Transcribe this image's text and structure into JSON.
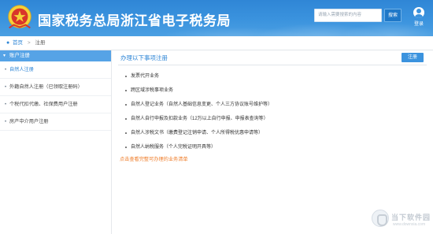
{
  "header": {
    "title": "国家税务总局浙江省电子税务局",
    "search": {
      "placeholder": "请输入需要搜索的内容",
      "button_label": "搜索"
    },
    "login_label": "登录",
    "colors": {
      "primary": "#3b93de",
      "accent_orange": "#ef7d2a"
    }
  },
  "breadcrumb": {
    "icon": "location-pin-icon",
    "home": "首页",
    "separator": ">",
    "current": "注册"
  },
  "sidebar": {
    "header_label": "账户注册",
    "items": [
      {
        "label": "自然人注册",
        "active": true
      },
      {
        "label": "外籍自然人注册（已领取注册码）",
        "active": false
      },
      {
        "label": "个税代扣代缴、社保费用户注册",
        "active": false
      },
      {
        "label": "房产中介用户注册",
        "active": false
      }
    ]
  },
  "main": {
    "title": "办理以下事项注册",
    "register_button": "注册",
    "items": [
      "发票代开业务",
      "跨区域涉税事项业务",
      "自然人登记业务（自然人基础信息变更、个人三方协议账号维护等）",
      "自然人自行申报及扣款业务（12万以上自行申报、申报表查询等）",
      "自然人涉税文书（缴费登记注销申请、个人所得税优惠申请等）",
      "自然人纳税服务（个人完税证明开具等）"
    ],
    "more_link": "点击查看完整可办理的业务清单"
  },
  "watermark": {
    "text": "当下软件园",
    "subtext": "www.downxia.com"
  }
}
